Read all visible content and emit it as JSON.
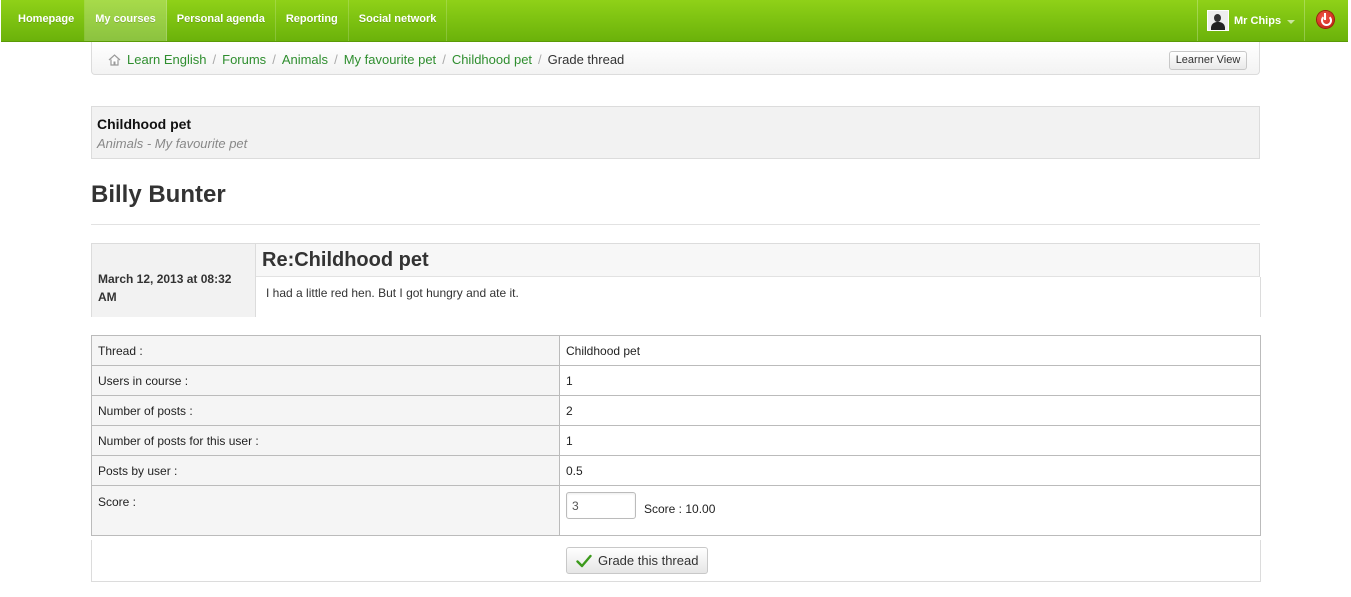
{
  "nav": {
    "items": [
      {
        "label": "Homepage",
        "active": false
      },
      {
        "label": "My courses",
        "active": true
      },
      {
        "label": "Personal agenda",
        "active": false
      },
      {
        "label": "Reporting",
        "active": false
      },
      {
        "label": "Social network",
        "active": false
      }
    ],
    "user_name": "Mr Chips"
  },
  "breadcrumb": {
    "links": [
      "Learn English",
      "Forums",
      "Animals",
      "My favourite pet",
      "Childhood pet"
    ],
    "current": "Grade thread",
    "separator": "/",
    "learner_view_label": "Learner View"
  },
  "thread": {
    "title": "Childhood pet",
    "subtitle": "Animals - My favourite pet"
  },
  "user_heading": "Billy Bunter",
  "post": {
    "date": "March 12, 2013 at 08:32 AM",
    "title": "Re:Childhood pet",
    "body": "I had a little red hen. But I got hungry and ate it."
  },
  "stats": {
    "thread_label": "Thread :",
    "thread_value": "Childhood pet",
    "users_label": "Users in course :",
    "users_value": "1",
    "posts_label": "Number of posts :",
    "posts_value": "2",
    "user_posts_label": "Number of posts for this user :",
    "user_posts_value": "1",
    "posts_by_user_label": "Posts by user :",
    "posts_by_user_value": "0.5",
    "score_label": "Score :",
    "score_value": "3",
    "score_max_text": "Score : 10.00"
  },
  "grade_button_label": "Grade this thread",
  "colors": {
    "nav_green": "#7cc10f",
    "link_green": "#2f8e2f",
    "power_red": "#d0241a"
  }
}
